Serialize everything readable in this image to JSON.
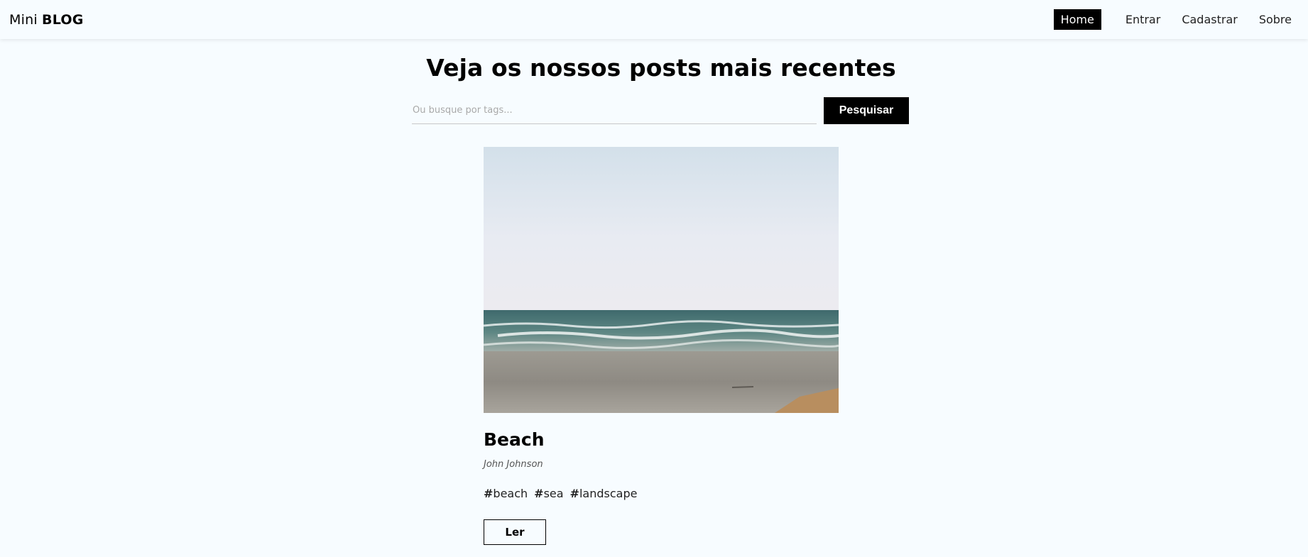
{
  "navbar": {
    "brand_light": "Mini",
    "brand_bold": "BLOG",
    "links": [
      {
        "label": "Home",
        "active": true
      },
      {
        "label": "Entrar",
        "active": false
      },
      {
        "label": "Cadastrar",
        "active": false
      },
      {
        "label": "Sobre",
        "active": false
      }
    ]
  },
  "main": {
    "title": "Veja os nossos posts mais recentes",
    "search": {
      "placeholder": "Ou busque por tags...",
      "value": "",
      "button_label": "Pesquisar"
    }
  },
  "posts": [
    {
      "title": "Beach",
      "author": "John Johnson",
      "tags": [
        "beach",
        "sea",
        "landscape"
      ],
      "read_label": "Ler"
    }
  ],
  "colors": {
    "page_background": "#f7fcff",
    "accent": "#000000",
    "nav_active_text": "#ffffff"
  }
}
